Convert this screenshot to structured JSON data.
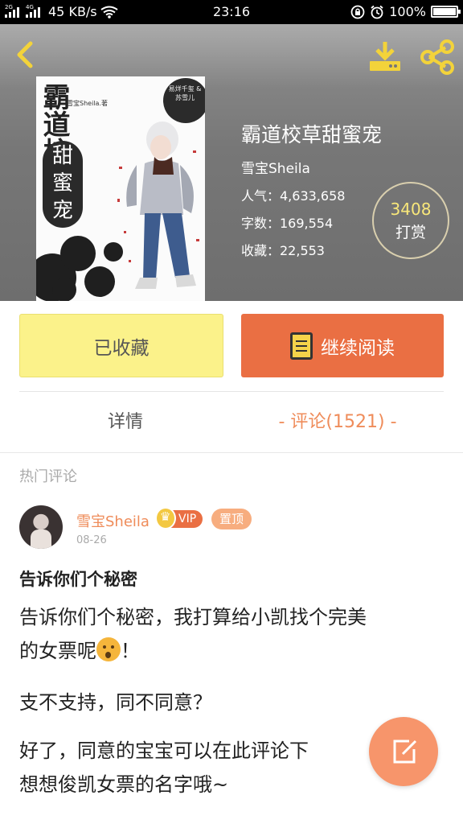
{
  "status_bar": {
    "network_speed": "45 KB/s",
    "time": "23:16",
    "battery": "100%",
    "generation_1": "2G",
    "generation_2": "4G"
  },
  "header": {
    "back_icon": "chevron-left-icon",
    "download_icon": "download-icon",
    "share_icon": "share-icon"
  },
  "cover": {
    "title_top": "霸道校草",
    "title_bottom": "甜蜜宠",
    "author_small": "雪宝Sheila.著",
    "cast": "易烊千玺 & 苏雪儿"
  },
  "book": {
    "title": "霸道校草甜蜜宠",
    "author": "雪宝Sheila",
    "popularity": "人气：4,633,658",
    "word_count": "字数：169,554",
    "favorites": "收藏：22,553",
    "tip_count": "3408",
    "tip_label": "打赏"
  },
  "actions": {
    "collected_label": "已收藏",
    "read_label": "继续阅读"
  },
  "tabs": {
    "detail": "详情",
    "comments": "- 评论(1521) -"
  },
  "comments": {
    "section_label": "热门评论",
    "items": [
      {
        "user": "雪宝Sheila",
        "vip": "VIP",
        "pinned": "置顶",
        "date": "08-26",
        "title": "告诉你们个秘密",
        "p1": "告诉你们个秘密，我打算给小凯找个完美",
        "p1b": "的女票呢",
        "p1c": "！",
        "p2": "支不支持，同不同意？",
        "p3": "好了，同意的宝宝可以在此评论下",
        "p3b": "想想俊凯女票的名字哦~"
      }
    ]
  },
  "colors": {
    "accent_orange": "#ea6f43",
    "collected_yellow": "#fbf28a",
    "tab_active": "#ef8c5a"
  }
}
